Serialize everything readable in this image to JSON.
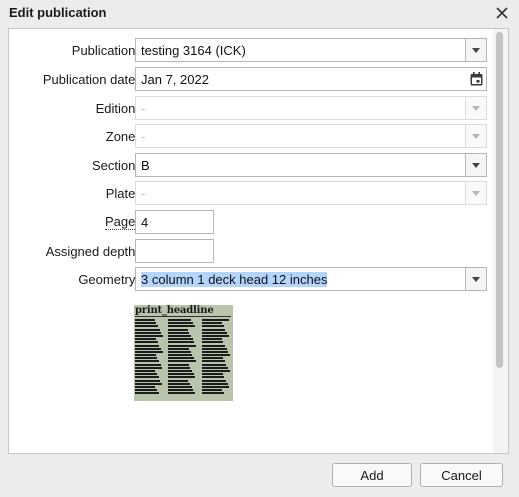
{
  "dialog": {
    "title": "Edit publication",
    "close_icon": "close-icon"
  },
  "form": {
    "publication": {
      "label": "Publication:",
      "value": "testing 3164 (ICK)"
    },
    "publication_date": {
      "label": "Publication date:",
      "value": "Jan 7, 2022",
      "icon": "calendar-icon"
    },
    "edition": {
      "label": "Edition:",
      "value": "-"
    },
    "zone": {
      "label": "Zone:",
      "value": "-"
    },
    "section": {
      "label": "Section:",
      "value": "B"
    },
    "plate": {
      "label": "Plate:",
      "value": "-"
    },
    "page": {
      "label": "Page:",
      "value": "4"
    },
    "assigned_depth": {
      "label": "Assigned depth:",
      "value": ""
    },
    "geometry": {
      "label": "Geometry:",
      "value": "3 column 1 deck head 12 inches"
    }
  },
  "preview": {
    "headline": "print_headline",
    "background_color": "#b9c4ad"
  },
  "footer": {
    "add_label": "Add",
    "cancel_label": "Cancel"
  }
}
